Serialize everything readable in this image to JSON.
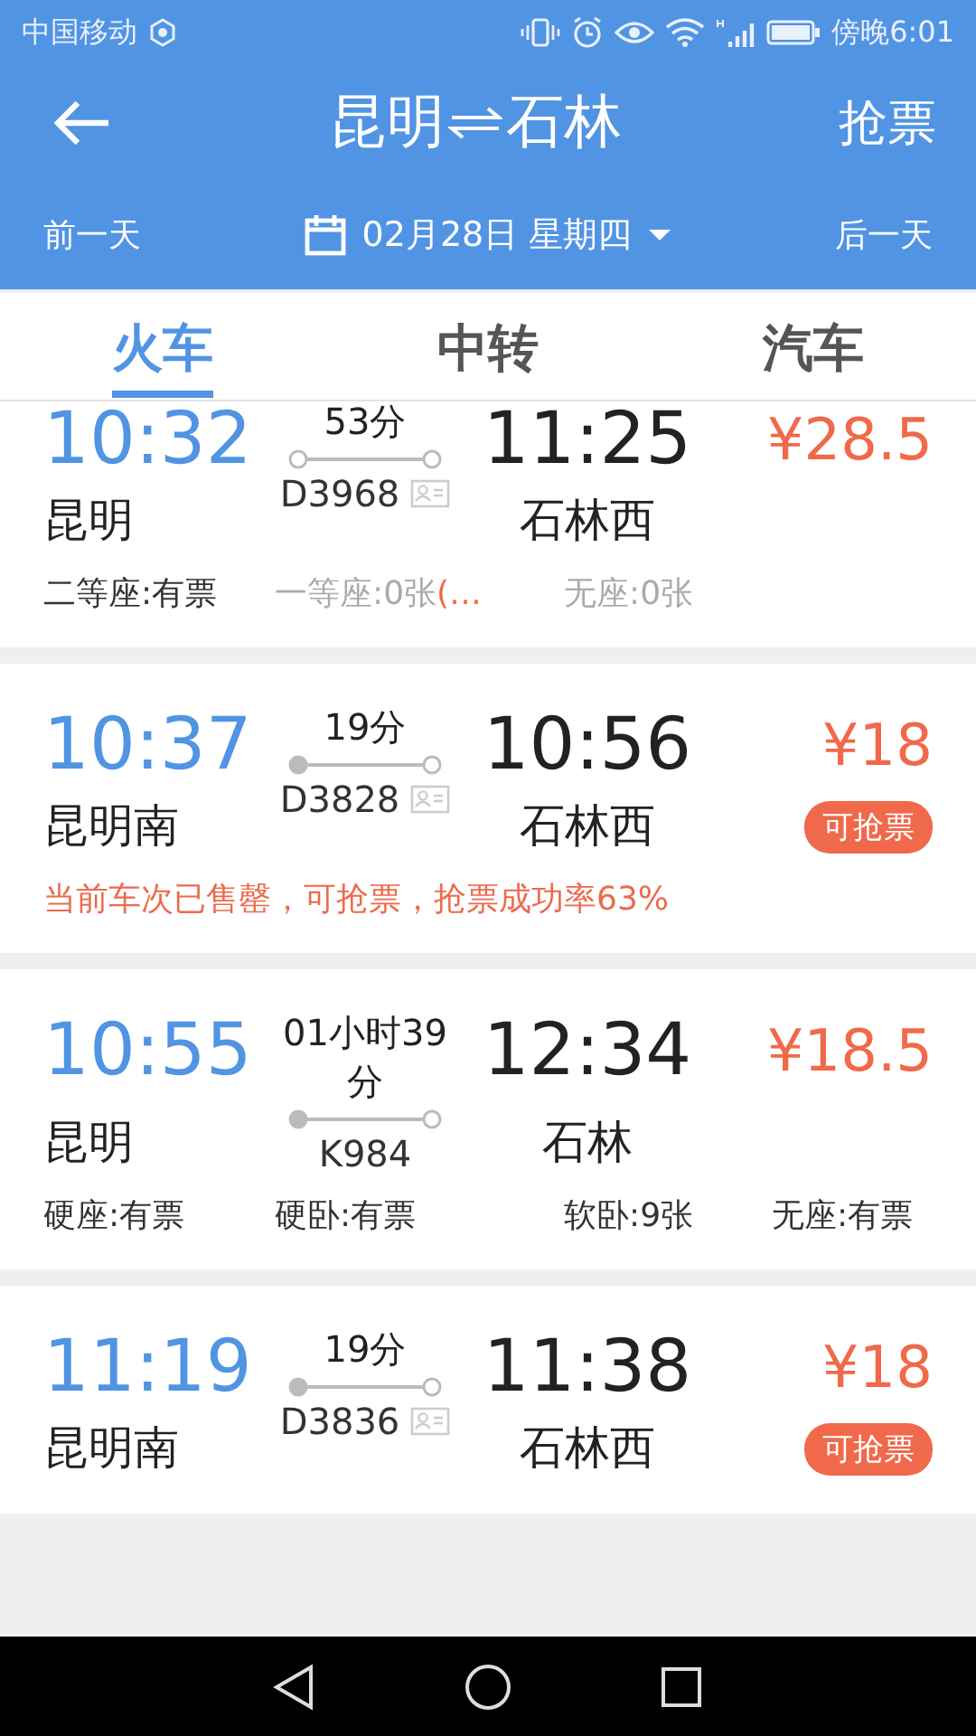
{
  "status_bar": {
    "carrier": "中国移动",
    "time": "傍晚6:01"
  },
  "header": {
    "from": "昆明",
    "to": "石林",
    "action": "抢票"
  },
  "date_bar": {
    "prev": "前一天",
    "date": "02月28日 星期四",
    "next": "后一天"
  },
  "tabs": [
    {
      "label": "火车",
      "selected": true
    },
    {
      "label": "中转",
      "selected": false
    },
    {
      "label": "汽车",
      "selected": false
    }
  ],
  "trains": [
    {
      "depart": "10:32",
      "from": "昆明",
      "duration": "53分",
      "number": "D3968",
      "id_card": true,
      "origin": false,
      "arrive": "11:25",
      "to": "石林西",
      "price": "¥28.5",
      "seats": [
        {
          "text": "二等座:有票",
          "available": true
        },
        {
          "text": "一等座:0张",
          "available": false,
          "note": "(…"
        },
        {
          "text": "无座:0张",
          "available": false
        }
      ]
    },
    {
      "depart": "10:37",
      "from": "昆明南",
      "duration": "19分",
      "number": "D3828",
      "id_card": true,
      "origin": true,
      "arrive": "10:56",
      "to": "石林西",
      "price": "¥18",
      "badge": "可抢票",
      "notice": "当前车次已售罄，可抢票，抢票成功率63%"
    },
    {
      "depart": "10:55",
      "from": "昆明",
      "duration": "01小时39分",
      "number": "K984",
      "id_card": false,
      "origin": true,
      "arrive": "12:34",
      "to": "石林",
      "price": "¥18.5",
      "seats": [
        {
          "text": "硬座:有票",
          "available": true
        },
        {
          "text": "硬卧:有票",
          "available": true
        },
        {
          "text": "软卧:9张",
          "available": true
        },
        {
          "text": "无座:有票",
          "available": true
        }
      ]
    },
    {
      "depart": "11:19",
      "from": "昆明南",
      "duration": "19分",
      "number": "D3836",
      "id_card": true,
      "origin": true,
      "arrive": "11:38",
      "to": "石林西",
      "price": "¥18",
      "badge": "可抢票"
    }
  ]
}
